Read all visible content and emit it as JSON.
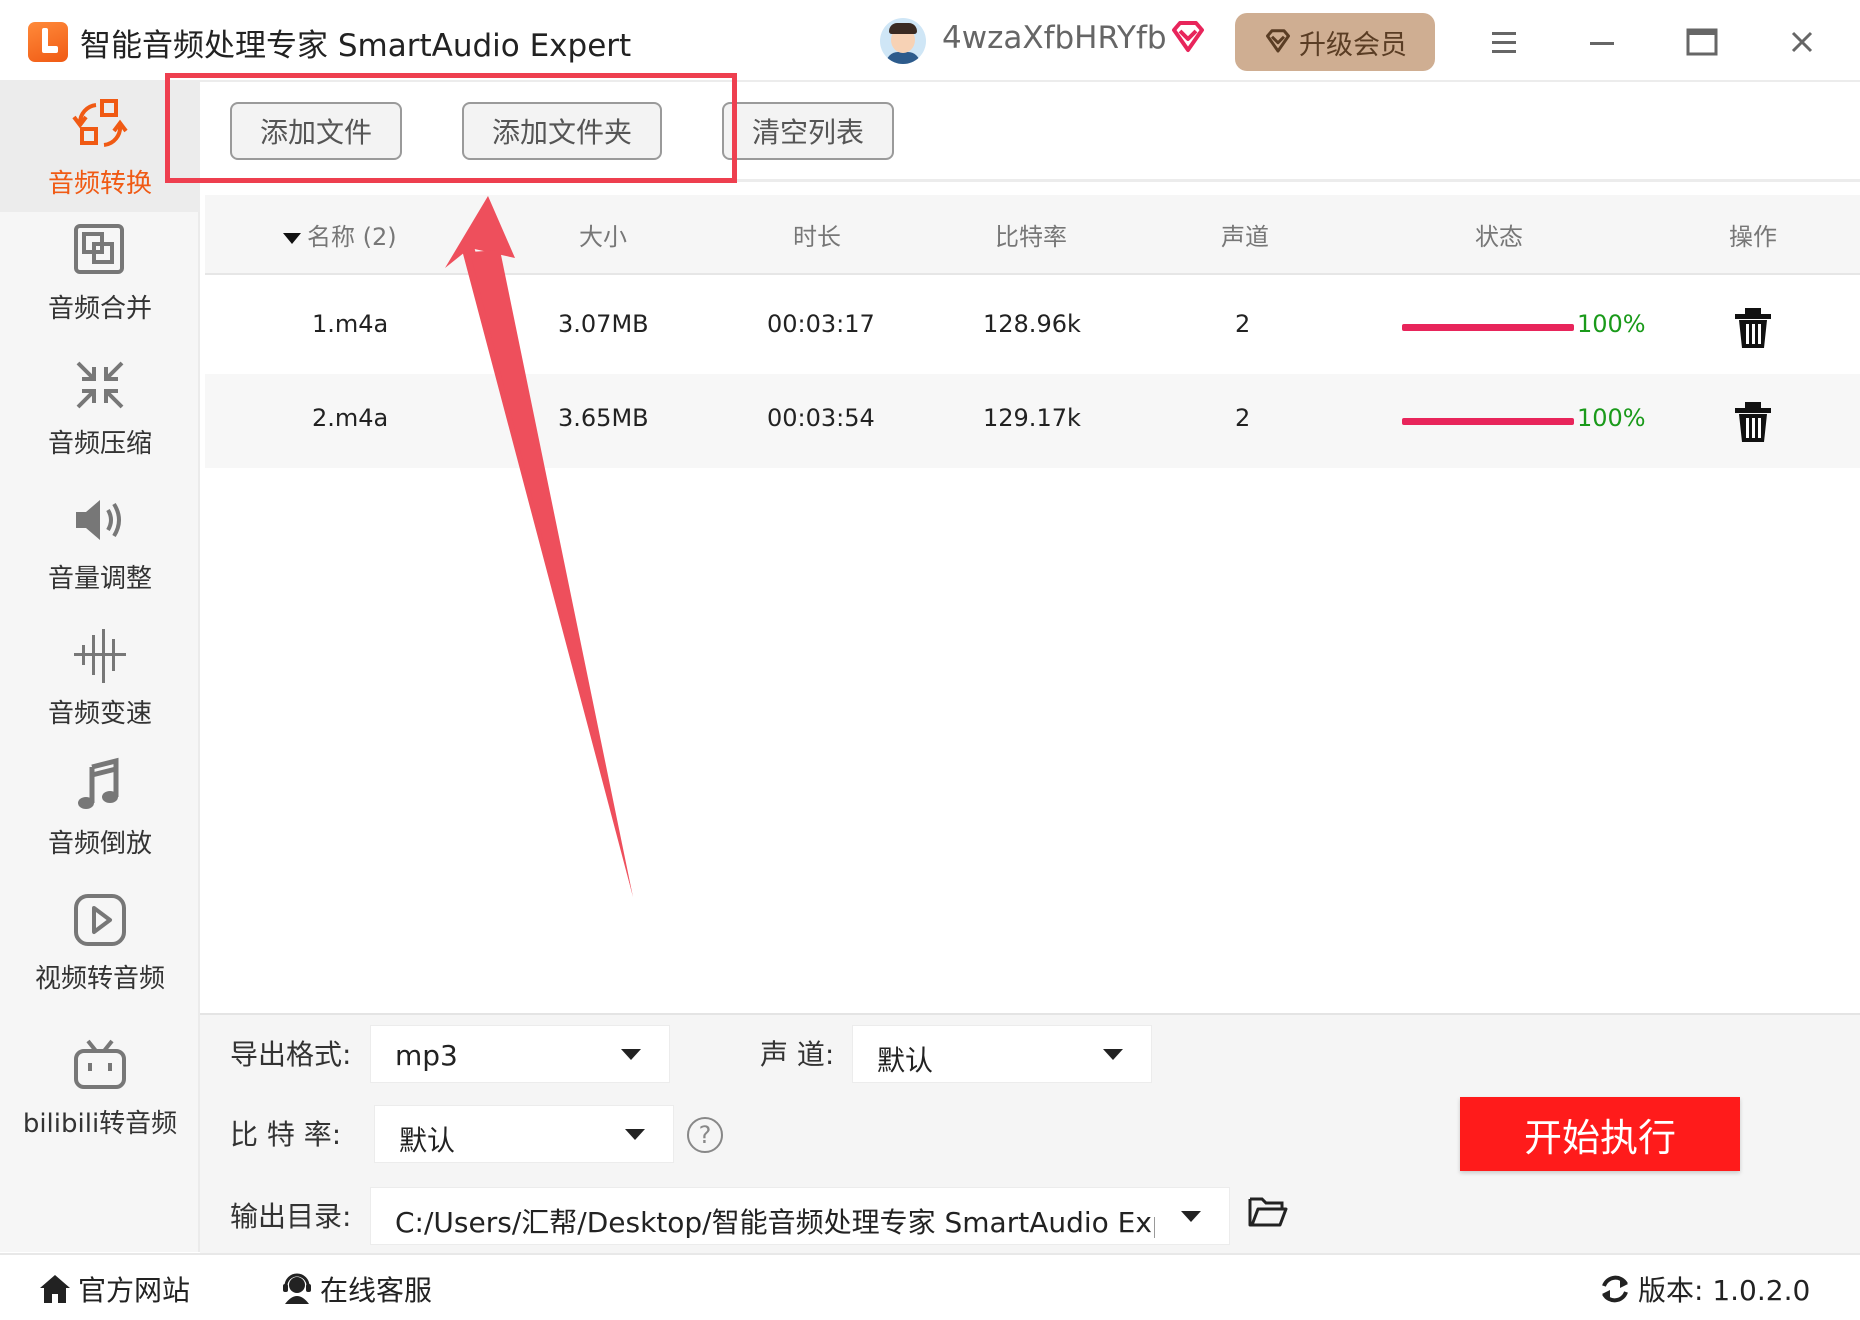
{
  "window": {
    "title": "智能音频处理专家 SmartAudio Expert",
    "username": "4wzaXfbHRYfb",
    "upgrade_label": "升级会员"
  },
  "sidebar": {
    "items": [
      {
        "label": "音频转换",
        "icon": "convert-icon",
        "active": true
      },
      {
        "label": "音频合并",
        "icon": "merge-icon"
      },
      {
        "label": "音频压缩",
        "icon": "compress-icon"
      },
      {
        "label": "音量调整",
        "icon": "volume-icon"
      },
      {
        "label": "音频变速",
        "icon": "speed-icon"
      },
      {
        "label": "音频倒放",
        "icon": "music-note-icon"
      },
      {
        "label": "视频转音频",
        "icon": "video-play-icon"
      },
      {
        "label": "bilibili转音频",
        "icon": "bilibili-icon"
      }
    ]
  },
  "toolbar": {
    "add_file": "添加文件",
    "add_folder": "添加文件夹",
    "clear_list": "清空列表"
  },
  "table": {
    "headers": {
      "name": "名称 (2)",
      "size": "大小",
      "duration": "时长",
      "bitrate": "比特率",
      "channels": "声道",
      "status": "状态",
      "action": "操作"
    },
    "rows": [
      {
        "name": "1.m4a",
        "size": "3.07MB",
        "duration": "00:03:17",
        "bitrate": "128.96k",
        "channels": "2",
        "progress": "100%"
      },
      {
        "name": "2.m4a",
        "size": "3.65MB",
        "duration": "00:03:54",
        "bitrate": "129.17k",
        "channels": "2",
        "progress": "100%"
      }
    ]
  },
  "settings": {
    "format_label": "导出格式:",
    "format_value": "mp3",
    "channel_label": "声 道:",
    "channel_value": "默认",
    "bitrate_label": "比 特 率:",
    "bitrate_value": "默认",
    "help": "?",
    "output_label": "输出目录:",
    "output_value": "C:/Users/汇帮/Desktop/智能音频处理专家 SmartAudio Exp",
    "start_label": "开始执行"
  },
  "footer": {
    "website": "官方网站",
    "support": "在线客服",
    "version": "版本:  1.0.2.0"
  },
  "colors": {
    "accent": "#f05a14",
    "progress": "#e8255b",
    "percent_text": "#1a9a1a",
    "start_button": "#ff1b1b",
    "highlight": "#ee3f4f",
    "upgrade_bg": "#cfae92"
  }
}
